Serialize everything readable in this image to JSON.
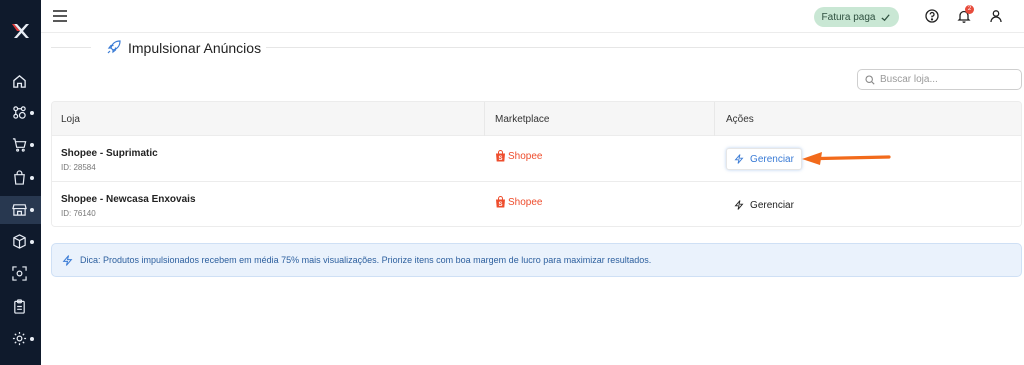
{
  "colors": {
    "sidebar": "#0f1a2c",
    "accent": "#3a7bd5",
    "shopee": "#ee4d2d",
    "fatura_bg": "#c9e7d4",
    "arrow": "#f26a1b"
  },
  "sidebar": {
    "logo": "x-logo-icon",
    "items": [
      {
        "icon": "home-icon",
        "dot": false
      },
      {
        "icon": "integrations-icon",
        "dot": true
      },
      {
        "icon": "cart-icon",
        "dot": true
      },
      {
        "icon": "bag-icon",
        "dot": true
      },
      {
        "icon": "store-icon",
        "dot": true,
        "active": true
      },
      {
        "icon": "box-icon",
        "dot": true
      },
      {
        "icon": "scan-icon",
        "dot": false
      },
      {
        "icon": "clipboard-icon",
        "dot": false
      },
      {
        "icon": "gear-icon",
        "dot": true
      }
    ]
  },
  "header": {
    "fatura_label": "Fatura paga",
    "notification_count": "2"
  },
  "page": {
    "title": "Impulsionar Anúncios"
  },
  "search": {
    "placeholder": "Buscar loja..."
  },
  "table": {
    "columns": [
      "Loja",
      "Marketplace",
      "Ações"
    ],
    "rows": [
      {
        "name": "Shopee - Suprimatic",
        "id": "ID: 28584",
        "marketplace": "Shopee",
        "action": "Gerenciar"
      },
      {
        "name": "Shopee - Newcasa Enxovais",
        "id": "ID: 76140",
        "marketplace": "Shopee",
        "action": "Gerenciar"
      }
    ]
  },
  "tip": {
    "text": "Dica: Produtos impulsionados recebem em média 75% mais visualizações. Priorize itens com boa margem de lucro para maximizar resultados."
  }
}
